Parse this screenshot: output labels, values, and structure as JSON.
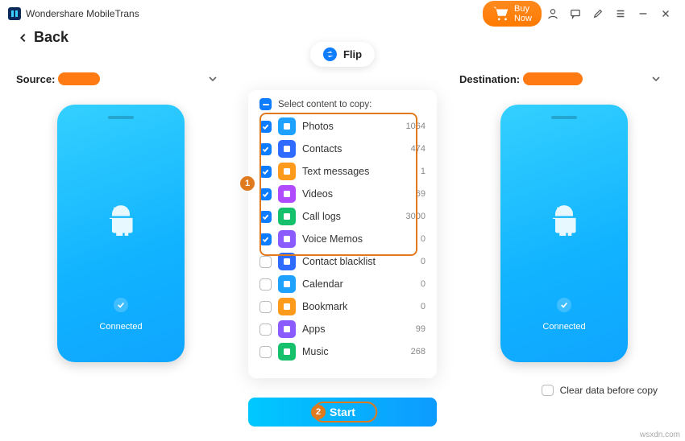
{
  "app_title": "Wondershare MobileTrans",
  "buy_label": "Buy Now",
  "back_label": "Back",
  "flip_label": "Flip",
  "source_label": "Source:",
  "destination_label": "Destination:",
  "connected_label": "Connected",
  "select_header": "Select content to copy:",
  "start_label": "Start",
  "clear_label": "Clear data before copy",
  "watermark": "wsxdn.com",
  "callout_1": "1",
  "callout_2": "2",
  "items": [
    {
      "name": "Photos",
      "count": 1064,
      "checked": true,
      "bg": "#1fa2ff"
    },
    {
      "name": "Contacts",
      "count": 474,
      "checked": true,
      "bg": "#2f6bff"
    },
    {
      "name": "Text messages",
      "count": 1,
      "checked": true,
      "bg": "#ff9b1c"
    },
    {
      "name": "Videos",
      "count": 69,
      "checked": true,
      "bg": "#b04bff"
    },
    {
      "name": "Call logs",
      "count": 3000,
      "checked": true,
      "bg": "#17c06b"
    },
    {
      "name": "Voice Memos",
      "count": 0,
      "checked": true,
      "bg": "#8a5bff"
    },
    {
      "name": "Contact blacklist",
      "count": 0,
      "checked": false,
      "bg": "#2f6bff"
    },
    {
      "name": "Calendar",
      "count": 0,
      "checked": false,
      "bg": "#1fa2ff"
    },
    {
      "name": "Bookmark",
      "count": 0,
      "checked": false,
      "bg": "#ff9b1c"
    },
    {
      "name": "Apps",
      "count": 99,
      "checked": false,
      "bg": "#8a5bff"
    },
    {
      "name": "Music",
      "count": 268,
      "checked": false,
      "bg": "#17c06b"
    }
  ]
}
